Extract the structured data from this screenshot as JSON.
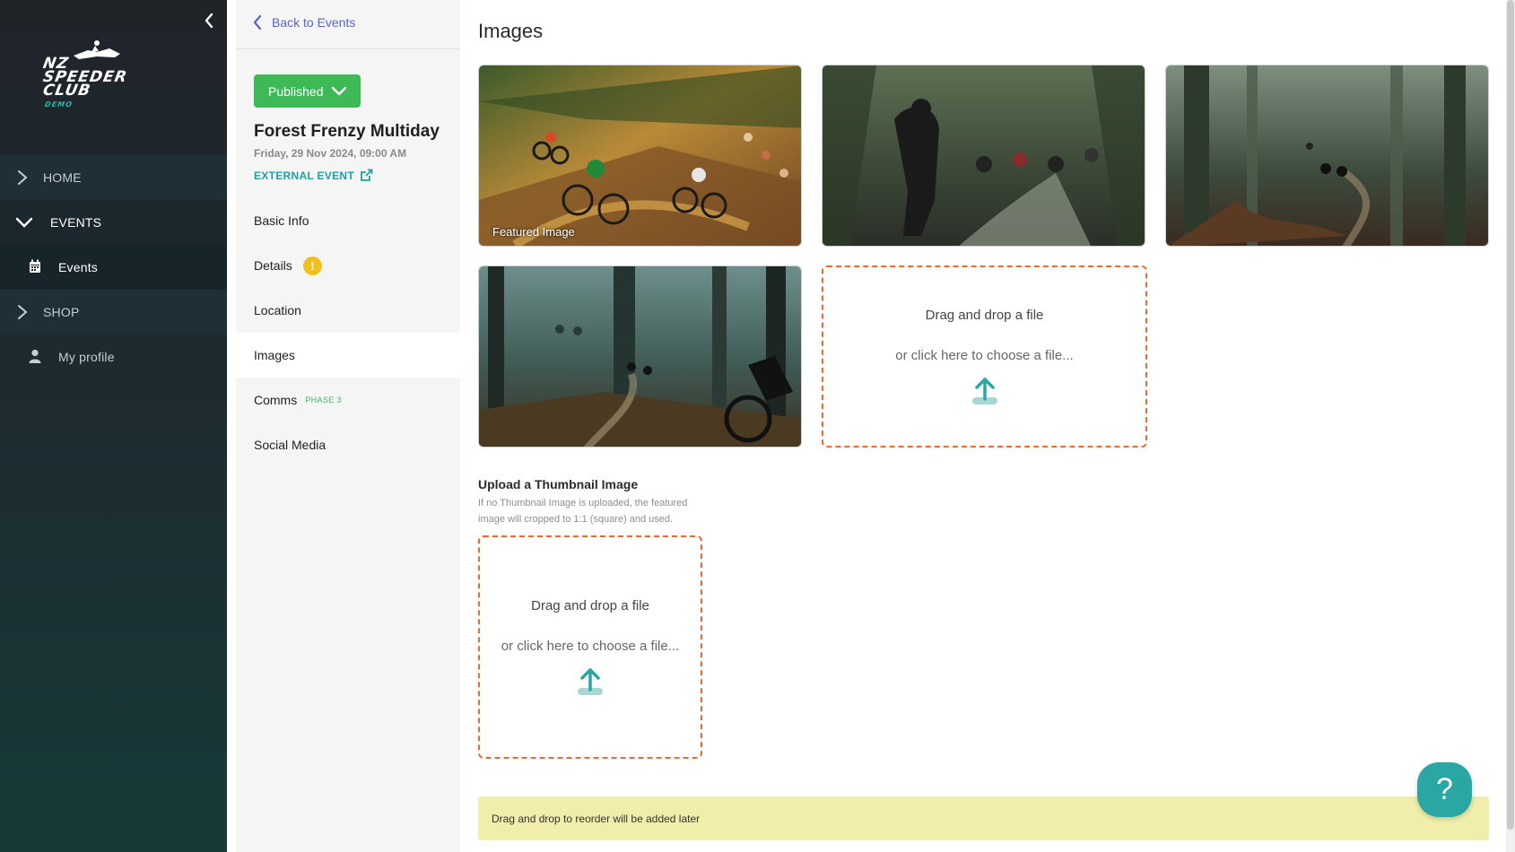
{
  "sidebar": {
    "logo": {
      "line1": "NZ",
      "line2": "SPEEDER",
      "line3": "CLUB",
      "tag": "DEMO"
    },
    "items": [
      {
        "label": "HOME",
        "icon": "chevron-right-icon"
      },
      {
        "label": "EVENTS",
        "icon": "chevron-down-icon"
      },
      {
        "label": "Events",
        "icon": "calendar-icon"
      },
      {
        "label": "SHOP",
        "icon": "chevron-right-icon"
      },
      {
        "label": "My profile",
        "icon": "person-icon"
      }
    ]
  },
  "event_panel": {
    "back_label": "Back to Events",
    "status_label": "Published",
    "title": "Forest Frenzy Multiday",
    "date": "Friday, 29 Nov 2024, 09:00 AM",
    "external_label": "EXTERNAL EVENT",
    "menu": [
      {
        "label": "Basic Info"
      },
      {
        "label": "Details",
        "badge": "!"
      },
      {
        "label": "Location"
      },
      {
        "label": "Images"
      },
      {
        "label": "Comms",
        "tag": "PHASE 3"
      },
      {
        "label": "Social Media"
      }
    ]
  },
  "main": {
    "title": "Images",
    "featured_label": "Featured Image",
    "dropzone": {
      "primary": "Drag and drop a file",
      "secondary": "or click here to choose a file..."
    },
    "thumbnail": {
      "heading": "Upload a Thumbnail Image",
      "help": "If no Thumbnail Image is uploaded, the featured image will cropped to 1:1 (square) and used."
    },
    "notice": "Drag and drop to reorder will be added later",
    "help_button": "?"
  },
  "colors": {
    "accent_teal": "#2aa7a4",
    "published_green": "#3dba55",
    "dropzone_orange": "#ee6a2c",
    "link_purple": "#5b63c8",
    "notice_yellow": "#f0eeaa",
    "warning_yellow": "#f2c01e"
  }
}
